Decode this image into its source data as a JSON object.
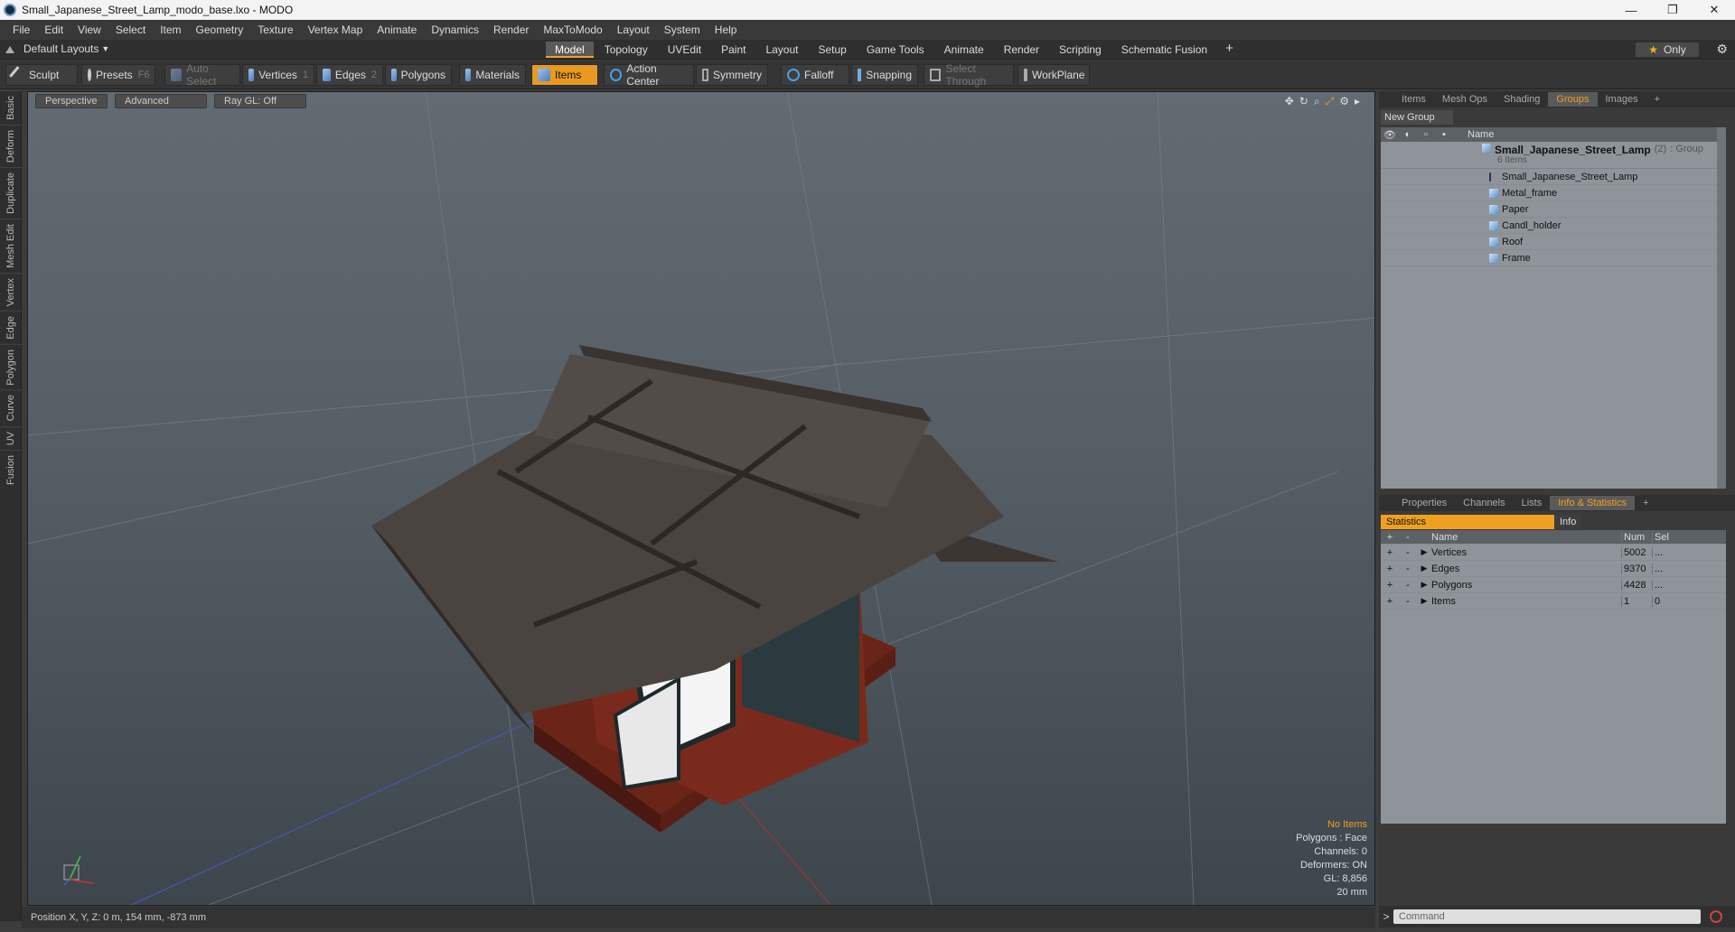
{
  "window": {
    "title": "Small_Japanese_Street_Lamp_modo_base.lxo - MODO",
    "controls": [
      "—",
      "❐",
      "✕"
    ]
  },
  "menu": [
    "File",
    "Edit",
    "View",
    "Select",
    "Item",
    "Geometry",
    "Texture",
    "Vertex Map",
    "Animate",
    "Dynamics",
    "Render",
    "MaxToModo",
    "Layout",
    "System",
    "Help"
  ],
  "layouts": {
    "label": "Default Layouts"
  },
  "mode_tabs": [
    "Model",
    "Topology",
    "UVEdit",
    "Paint",
    "Layout",
    "Setup",
    "Game Tools",
    "Animate",
    "Render",
    "Scripting",
    "Schematic Fusion"
  ],
  "active_mode_tab": "Model",
  "only_label": "Only",
  "toolbar": {
    "sculpt": "Sculpt",
    "presets": "Presets",
    "presets_key": "F6",
    "auto_select": "Auto Select",
    "vertices": "Vertices",
    "vertices_key": "1",
    "edges": "Edges",
    "edges_key": "2",
    "polygons": "Polygons",
    "materials": "Materials",
    "items": "Items",
    "action_center": "Action Center",
    "symmetry": "Symmetry",
    "falloff": "Falloff",
    "snapping": "Snapping",
    "select_through": "Select Through",
    "workplane": "WorkPlane"
  },
  "left_tabs": [
    "Basic",
    "Deform",
    "Duplicate",
    "Mesh Edit",
    "Vertex",
    "Edge",
    "Polygon",
    "Curve",
    "UV",
    "Fusion"
  ],
  "viewport": {
    "view": "Perspective",
    "advanced": "Advanced",
    "raygl": "Ray GL: Off",
    "info": {
      "no_items": "No Items",
      "polygons": "Polygons : Face",
      "channels": "Channels: 0",
      "deformers": "Deformers: ON",
      "gl": "GL: 8,856",
      "scale": "20 mm"
    }
  },
  "status": {
    "position": "Position X, Y, Z:  0 m, 154 mm, -873 mm"
  },
  "right_top_tabs": [
    "Items",
    "Mesh Ops",
    "Shading",
    "Groups",
    "Images"
  ],
  "right_top_active": "Groups",
  "groups": {
    "new_group": "New Group",
    "col_name": "Name",
    "group_name": "Small_Japanese_Street_Lamp",
    "group_count": "(2)",
    "group_type": ": Group",
    "group_sub": "6 Items",
    "children": [
      "Small_Japanese_Street_Lamp",
      "Metal_frame",
      "Paper",
      "Candl_holder",
      "Roof",
      "Frame"
    ]
  },
  "right_bottom_tabs": [
    "Properties",
    "Channels",
    "Lists",
    "Info & Statistics"
  ],
  "right_bottom_active": "Info & Statistics",
  "stats": {
    "tab_statistics": "Statistics",
    "tab_info": "Info",
    "col_name": "Name",
    "col_num": "Num",
    "col_sel": "Sel",
    "rows": [
      {
        "name": "Vertices",
        "num": "5002",
        "sel": "..."
      },
      {
        "name": "Edges",
        "num": "9370",
        "sel": "..."
      },
      {
        "name": "Polygons",
        "num": "4428",
        "sel": "..."
      },
      {
        "name": "Items",
        "num": "1",
        "sel": "0"
      }
    ]
  },
  "command": {
    "placeholder": "Command"
  }
}
